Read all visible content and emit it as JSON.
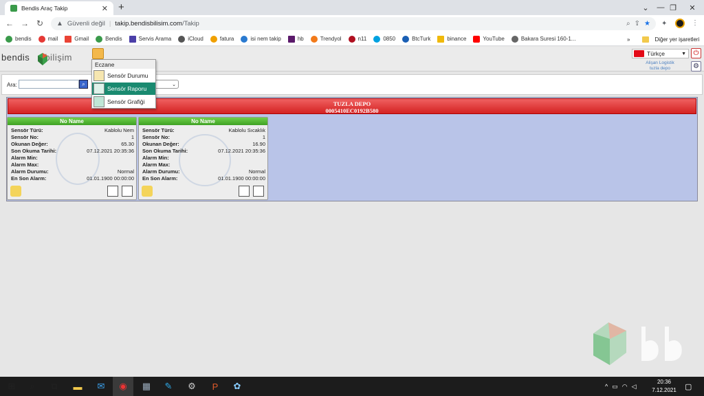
{
  "browser": {
    "tab_title": "Bendis Araç Takip",
    "security_label": "Güvenli değil",
    "url_host": "takip.bendisbilisim.com",
    "url_path": "/Takip",
    "bookmarks": [
      "bendis",
      "mail",
      "Gmail",
      "Bendis",
      "Servis Arama",
      "iCloud",
      "fatura",
      "isi nem takip",
      "hb",
      "Trendyol",
      "n11",
      "0850",
      "BtcTurk",
      "binance",
      "YouTube",
      "Bakara Suresi 160-1..."
    ],
    "bookmarks_more": "»",
    "other_bookmarks": "Diğer yer işaretleri"
  },
  "app": {
    "logo_left": "bendis",
    "logo_right": "bilişim",
    "language": "Türkçe",
    "user_line1": "Alişan Logistik",
    "user_line2": "tuzla depo",
    "search_label": "Ara:",
    "search_value": ""
  },
  "menu": {
    "header": "Eczane",
    "items": [
      "Sensör Durumu",
      "Sensör Raporu",
      "Sensör Grafiği"
    ],
    "selected_index": 1
  },
  "depot": {
    "name": "TUZLA DEPO",
    "code": "0005410EC0192B580"
  },
  "field_labels": {
    "type": "Sensör Türü:",
    "no": "Sensör No:",
    "value": "Okunan Değer:",
    "last_read": "Son Okuma Tarihi:",
    "alarm_min": "Alarm Min:",
    "alarm_max": "Alarm Max:",
    "alarm_status": "Alarm Durumu:",
    "last_alarm": "En Son Alarm:"
  },
  "sensors": [
    {
      "title": "No Name",
      "type": "Kablolu Nem",
      "no": "1",
      "value": "65.30",
      "last_read": "07.12.2021 20:35:36",
      "alarm_min": "",
      "alarm_max": "",
      "alarm_status": "Normal",
      "last_alarm": "01.01.1900 00:00:00",
      "kind": "humidity"
    },
    {
      "title": "No Name",
      "type": "Kablolu Sıcaklık",
      "no": "1",
      "value": "16.90",
      "last_read": "07.12.2021 20:35:36",
      "alarm_min": "",
      "alarm_max": "",
      "alarm_status": "Normal",
      "last_alarm": "01.01.1900 00:00:00",
      "kind": "temperature"
    }
  ],
  "taskbar": {
    "time": "20:36",
    "date": "7.12.2021"
  },
  "colors": {
    "depot_header": "#d42222",
    "card_header": "#3fa224",
    "depot_bg": "#b9c4e8",
    "menu_selected": "#1a8a70"
  }
}
